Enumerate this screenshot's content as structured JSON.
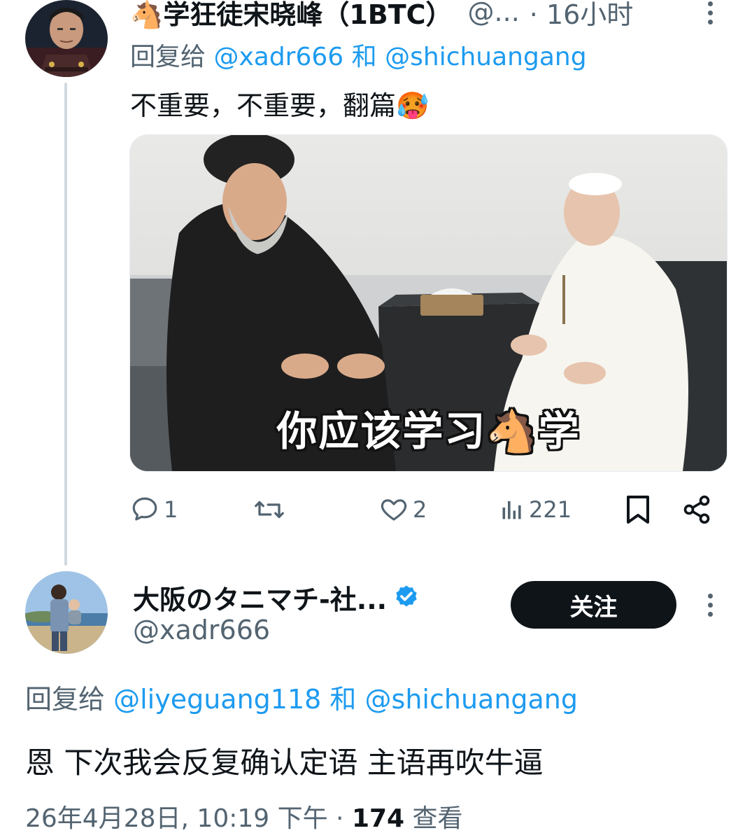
{
  "tweet1": {
    "avatar_icon": "user-avatar-uniform",
    "display_name": "🐴学狂徒宋晓峰（1BTC）",
    "handle": "@...",
    "time": "· 16小时",
    "reply_prefix": "回复给",
    "reply_mention_1": "@xadr666",
    "reply_and": "和",
    "reply_mention_2": "@shichuangang",
    "text": "不重要，不重要，翻篇🥵",
    "image_caption": "你应该学习🐴学",
    "actions": {
      "reply_count": "1",
      "retweet_count": "",
      "like_count": "2",
      "view_count": "221"
    }
  },
  "tweet2": {
    "avatar_icon": "user-avatar-photo",
    "display_name": "大阪のタニマチ-社...",
    "verified_icon": "verified-badge-icon",
    "handle": "@xadr666",
    "follow_label": "关注",
    "reply_prefix": "回复给",
    "reply_mention_1": "@liyeguang118",
    "reply_and": "和",
    "reply_mention_2": "@shichuangang",
    "text": "恩 下次我会反复确认定语 主语再吹牛逼",
    "timestamp": "26年4月28日, 10:19 下午 · ",
    "views_count": "174",
    "views_label": " 查看"
  },
  "colors": {
    "accent": "#1d9bf0",
    "text_primary": "#0f1419",
    "text_secondary": "#536471",
    "button_bg": "#0f1419"
  }
}
